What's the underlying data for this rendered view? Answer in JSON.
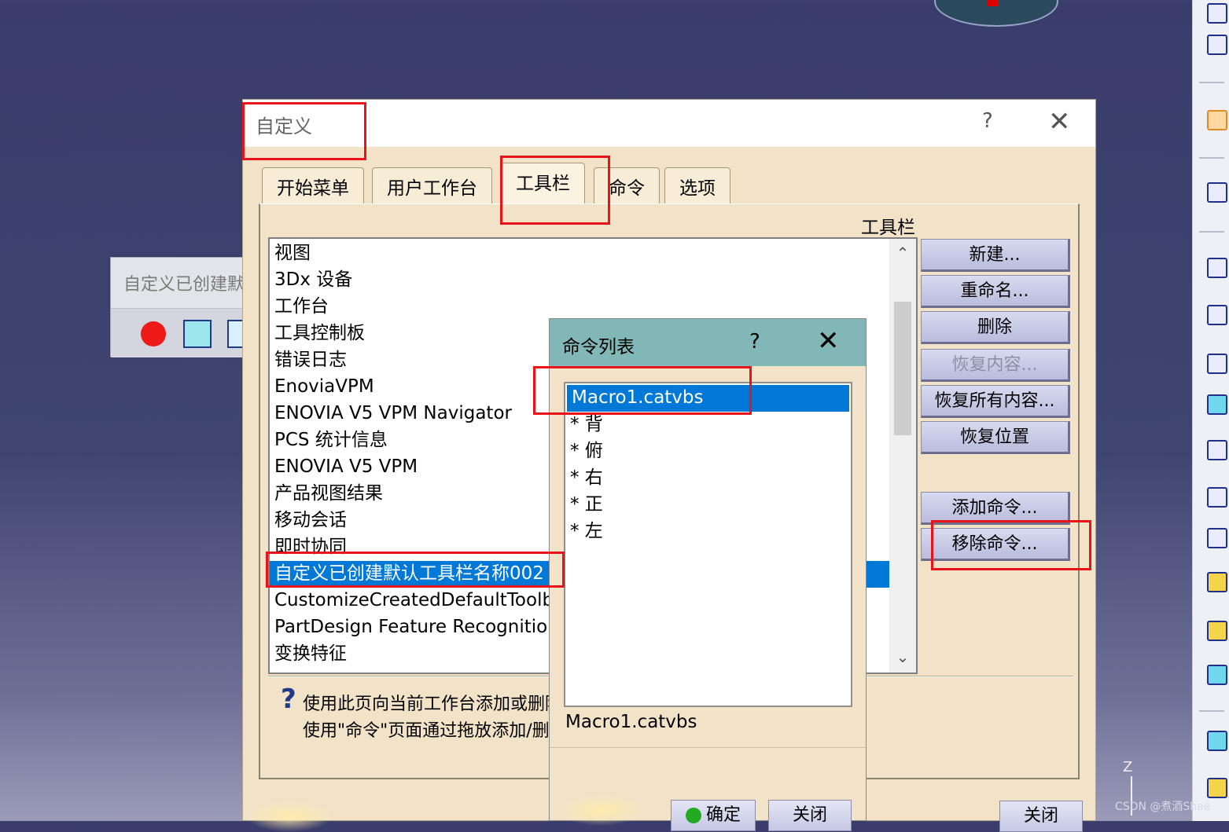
{
  "user_toolbar": {
    "title": "自定义已创建默认工具栏名称002"
  },
  "customize_dialog": {
    "title": "自定义",
    "help_label": "?",
    "close_label": "✕",
    "tabs": [
      "开始菜单",
      "用户工作台",
      "工具栏",
      "命令",
      "选项"
    ],
    "active_tab": "工具栏",
    "toolbar_list_label": "工具栏",
    "toolbars": [
      "视图",
      "3Dx 设备",
      "工作台",
      "工具控制板",
      "错误日志",
      "EnoviaVPM",
      "ENOVIA V5 VPM Navigator",
      "PCS 统计信息",
      "ENOVIA V5 VPM",
      "产品视图结果",
      "移动会话",
      "即时协同",
      "自定义已创建默认工具栏名称002",
      "CustomizeCreatedDefaultToolbar",
      "PartDesign Feature Recognition",
      "变换特征"
    ],
    "selected_toolbar": "自定义已创建默认工具栏名称002",
    "buttons": {
      "new": "新建...",
      "rename": "重命名...",
      "delete": "删除",
      "restore_contents": "恢复内容...",
      "restore_all_contents": "恢复所有内容...",
      "restore_position": "恢复位置",
      "add_command": "添加命令...",
      "remove_command": "移除命令..."
    },
    "help_text_line1": "使用此页向当前工作台添加或删除工具栏",
    "help_text_line2": "使用\"命令\"页面通过拖放添加/删除命令",
    "close_button": "关闭"
  },
  "command_dialog": {
    "title": "命令列表",
    "help_label": "?",
    "close_label": "✕",
    "commands": [
      "Macro1.catvbs",
      "* 背",
      "* 俯",
      "* 右",
      "* 正",
      "* 左"
    ],
    "selected_command": "Macro1.catvbs",
    "ok_button": "确定",
    "close_button": "关闭"
  },
  "viewer": {
    "axis_label": "Z",
    "watermark": "CSDN @煮酒Shae"
  },
  "colors": {
    "selection": "#0078d7",
    "highlight_box": "#e8141a",
    "dialog_bg": "#f2e3c8",
    "command_titlebar": "#81b7b6"
  }
}
